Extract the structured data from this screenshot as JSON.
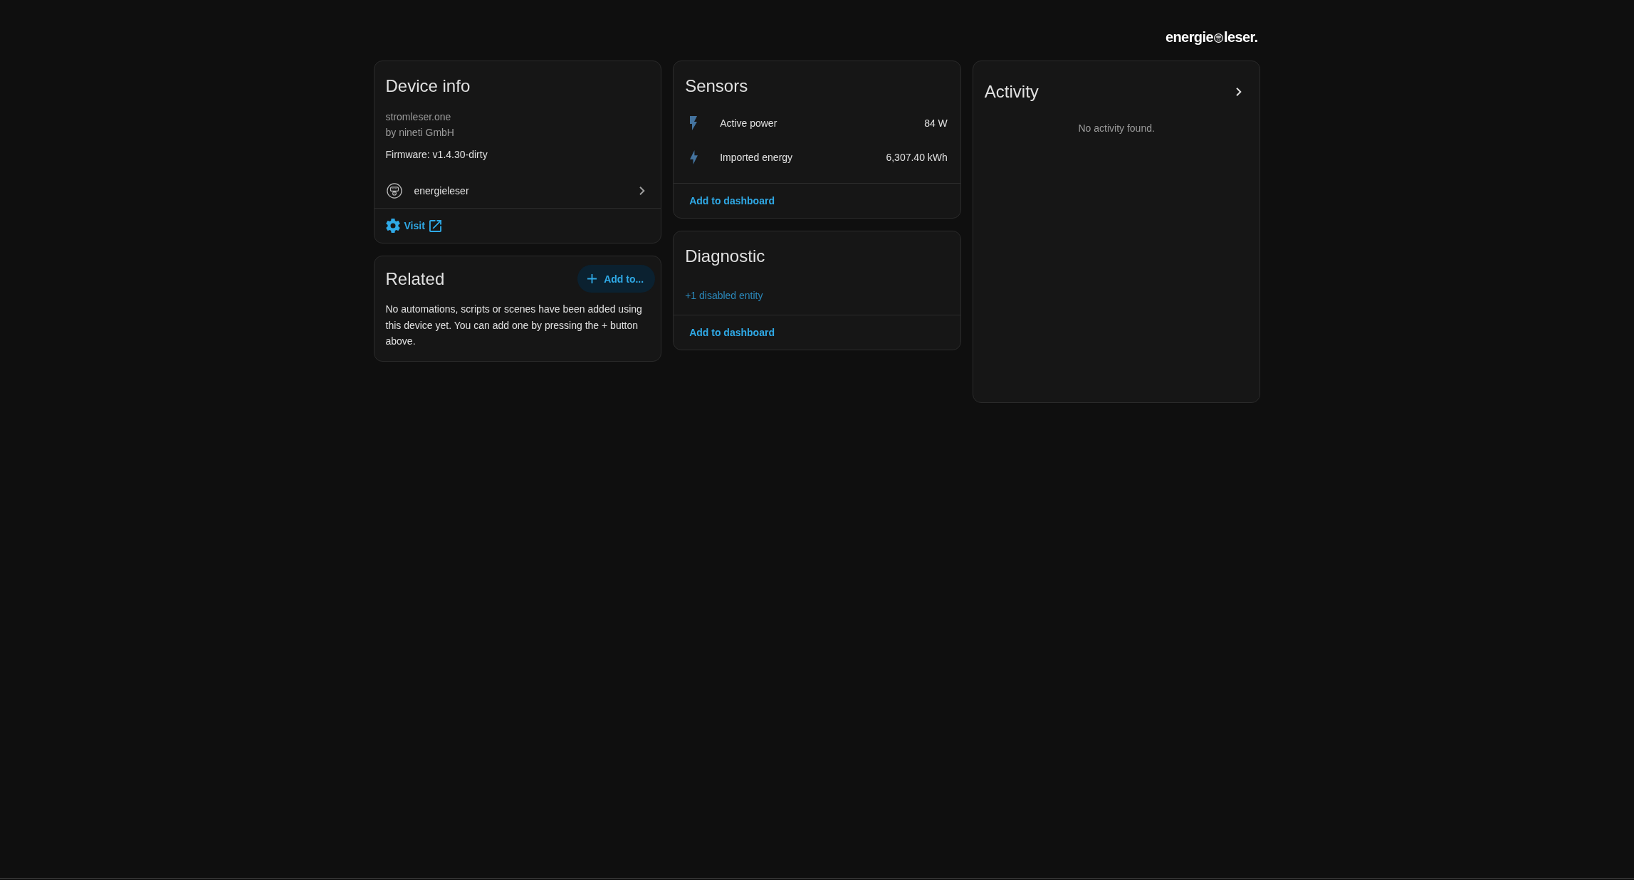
{
  "logo": {
    "text_before": "energie",
    "text_after": "leser."
  },
  "device_info": {
    "title": "Device info",
    "model": "stromleser.one",
    "manufacturer": "by nineti GmbH",
    "firmware": "Firmware: v1.4.30-dirty",
    "via_device": "energieleser",
    "visit_link": "Visit"
  },
  "related": {
    "title": "Related",
    "add_button": "Add to...",
    "message": "No automations, scripts or scenes have been added using this device yet. You can add one by pressing the + button above."
  },
  "sensors": {
    "title": "Sensors",
    "entities": [
      {
        "kind": "power",
        "name": "Active power",
        "value": "84 W"
      },
      {
        "kind": "energy",
        "name": "Imported energy",
        "value": "6,307.40 kWh"
      }
    ],
    "action": "Add to dashboard"
  },
  "diagnostic": {
    "title": "Diagnostic",
    "disabled_link": "+1 disabled entity",
    "action": "Add to dashboard"
  },
  "activity": {
    "title": "Activity",
    "empty_message": "No activity found."
  }
}
